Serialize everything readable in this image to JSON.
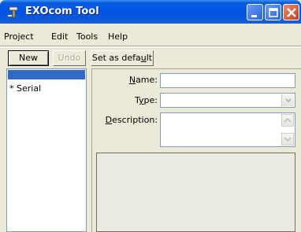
{
  "window": {
    "title": "EXOcom Tool",
    "icon": "hammer-icon"
  },
  "menu": {
    "items": [
      "Project",
      "Edit",
      "Tools",
      "Help"
    ]
  },
  "toolbar": {
    "new_label": "New",
    "undo_label": "Undo",
    "set_default_prefix": "Set as defa",
    "set_default_mnemonic": "u",
    "set_default_suffix": "lt"
  },
  "list": {
    "items": [
      "* Serial"
    ],
    "selected_index": 0
  },
  "form": {
    "name_label_mnemonic": "N",
    "name_label_rest": "ame:",
    "name_value": "",
    "type_label_prefix": "T",
    "type_label_mnemonic": "y",
    "type_label_rest": "pe:",
    "type_value": "",
    "description_label_mnemonic": "D",
    "description_label_rest": "escription:",
    "description_value": ""
  }
}
